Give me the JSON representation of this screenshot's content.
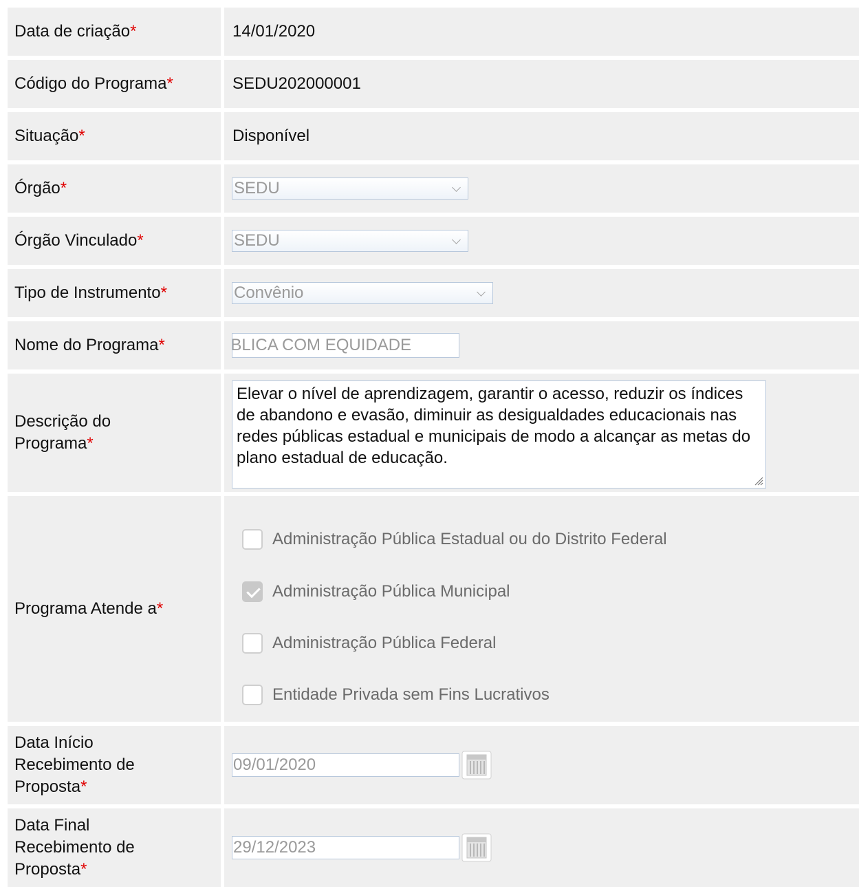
{
  "fields": {
    "data_criacao": {
      "label": "Data de criação",
      "required": "*",
      "value": "14/01/2020"
    },
    "codigo_programa": {
      "label": "Código do Programa",
      "required": "*",
      "value": "SEDU202000001"
    },
    "situacao": {
      "label": "Situação",
      "required": "*",
      "value": "Disponível"
    },
    "orgao": {
      "label": "Órgão",
      "required": "*",
      "value": "SEDU"
    },
    "orgao_vinculado": {
      "label": "Órgão Vinculado",
      "required": "*",
      "value": "SEDU"
    },
    "tipo_instrumento": {
      "label": "Tipo de Instrumento",
      "required": "*",
      "value": "Convênio"
    },
    "nome_programa": {
      "label": "Nome do Programa",
      "required": "*",
      "value": "ÚBLICA COM EQUIDADE"
    },
    "descricao_programa": {
      "label_line1": "Descrição do",
      "label_line2": "Programa",
      "required": "*",
      "value": "Elevar o nível de aprendizagem, garantir o acesso, reduzir os índices de abandono e evasão, diminuir as desigualdades educacionais nas redes públicas estadual e municipais de modo a alcançar as metas do plano estadual de educação."
    },
    "programa_atende": {
      "label": "Programa Atende a",
      "required": "*",
      "options": [
        {
          "label": "Administração Pública Estadual ou do Distrito Federal",
          "checked": false
        },
        {
          "label": "Administração Pública Municipal",
          "checked": true
        },
        {
          "label": "Administração Pública Federal",
          "checked": false
        },
        {
          "label": "Entidade Privada sem Fins Lucrativos",
          "checked": false
        }
      ]
    },
    "data_inicio": {
      "label_line1": "Data Início",
      "label_line2": "Recebimento de",
      "label_line3": "Proposta",
      "required": "*",
      "value": "09/01/2020"
    },
    "data_final": {
      "label_line1": "Data Final",
      "label_line2": "Recebimento de",
      "label_line3": "Proposta",
      "required": "*",
      "value": "29/12/2023"
    }
  },
  "icons": {
    "calendar": "calendar-icon",
    "dropdown": "chevron-down-icon",
    "checkmark": "checkmark-icon",
    "resize": "resize-grip-icon"
  },
  "colors": {
    "required": "#e00000",
    "row_bg": "#efefef",
    "disabled_text": "#9a9a9a",
    "input_border": "#b8c8dc"
  }
}
